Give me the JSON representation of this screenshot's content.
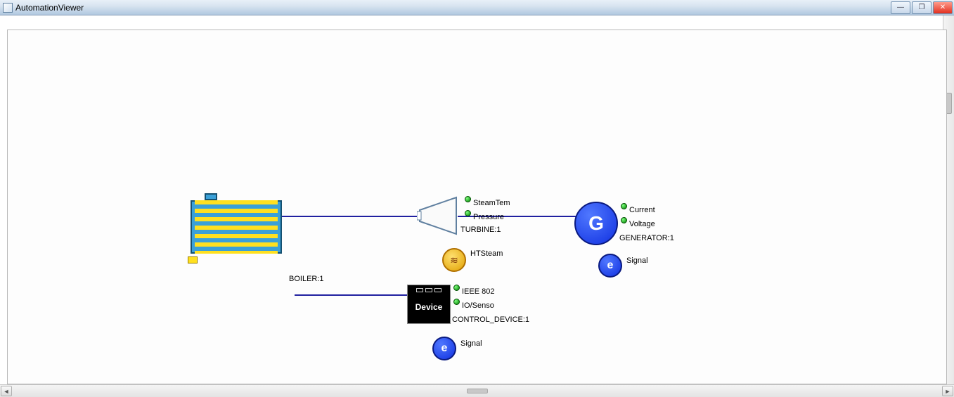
{
  "window": {
    "title": "AutomationViewer"
  },
  "diagram": {
    "boiler": {
      "label": "BOILER:1"
    },
    "turbine": {
      "label": "TURBINE:1",
      "port_steamtem": "SteamTem",
      "port_pressure": "Pressure"
    },
    "htsteam": {
      "label": "HTSteam"
    },
    "control": {
      "label": "CONTROL_DEVICE:1",
      "box_text": "Device",
      "port_ieee": "IEEE 802",
      "port_io": "IO/Senso"
    },
    "generator": {
      "label": "GENERATOR:1",
      "glyph": "G",
      "port_current": "Current",
      "port_voltage": "Voltage"
    },
    "signal_gen": {
      "glyph": "e",
      "label": "Signal"
    },
    "signal_ctrl": {
      "glyph": "e",
      "label": "Signal"
    }
  }
}
